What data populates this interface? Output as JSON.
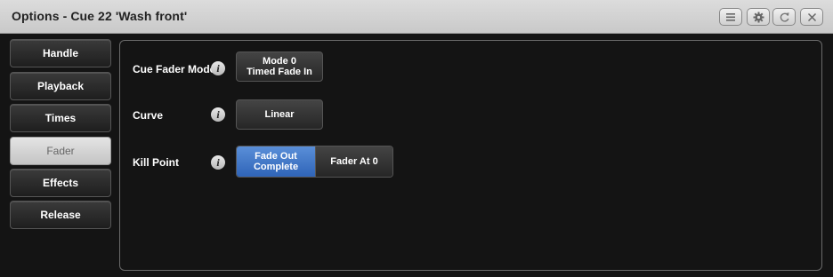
{
  "window": {
    "title": "Options - Cue 22 'Wash front'",
    "buttons": [
      "menu-icon",
      "gear-icon",
      "refresh-icon",
      "close-icon"
    ]
  },
  "sidebar": {
    "items": [
      {
        "label": "Handle",
        "active": false
      },
      {
        "label": "Playback",
        "active": false
      },
      {
        "label": "Times",
        "active": false
      },
      {
        "label": "Fader",
        "active": true
      },
      {
        "label": "Effects",
        "active": false
      },
      {
        "label": "Release",
        "active": false
      }
    ]
  },
  "options": {
    "cue_fader_mode": {
      "label": "Cue Fader Mode",
      "value_line1": "Mode 0",
      "value_line2": "Timed Fade In"
    },
    "curve": {
      "label": "Curve",
      "value": "Linear"
    },
    "kill_point": {
      "label": "Kill Point",
      "choices": [
        {
          "line1": "Fade Out",
          "line2": "Complete",
          "selected": true
        },
        {
          "line1": "Fader At 0",
          "line2": "",
          "selected": false
        }
      ]
    },
    "info_glyph": "i"
  },
  "colors": {
    "accent": "#3f78cc",
    "titlebar": "#d2d2d2",
    "background": "#141414"
  }
}
